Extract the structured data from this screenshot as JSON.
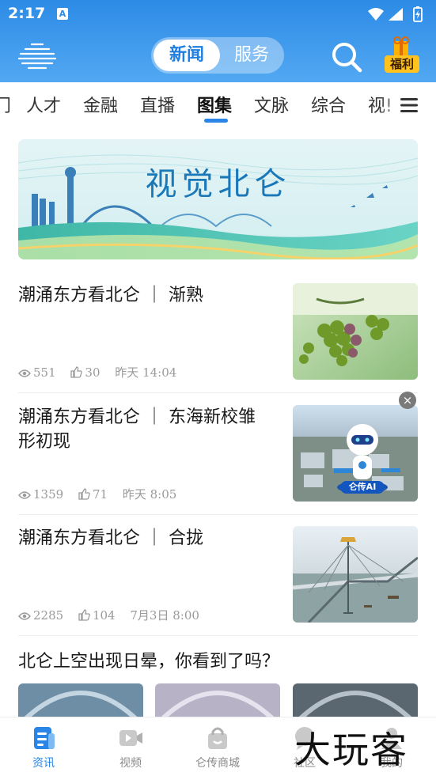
{
  "status_bar": {
    "time": "2:17",
    "notification_icon": "A"
  },
  "header": {
    "switch": {
      "active": "新闻",
      "inactive": "服务"
    },
    "welfare_label": "福利",
    "colors": {
      "header_top": "#2d8be6",
      "accent": "#2a86e6"
    }
  },
  "tabs": [
    {
      "label": "门"
    },
    {
      "label": "人才"
    },
    {
      "label": "金融"
    },
    {
      "label": "直播"
    },
    {
      "label": "图集"
    },
    {
      "label": "文脉"
    },
    {
      "label": "综合"
    },
    {
      "label": "视!"
    }
  ],
  "active_tab": "图集",
  "banner": {
    "title": "视觉北仑"
  },
  "news": [
    {
      "title": "潮涌东方看北仑 ｜ 渐熟",
      "views": "551",
      "likes": "30",
      "time": "昨天 14:04",
      "thumb": "grapes"
    },
    {
      "title": "潮涌东方看北仑 ｜ 东海新校雏形初现",
      "views": "1359",
      "likes": "71",
      "time": "昨天 8:05",
      "thumb": "campus-aerial",
      "overlay_label": "仑传AI"
    },
    {
      "title": "潮涌东方看北仑 ｜ 合拢",
      "views": "2285",
      "likes": "104",
      "time": "7月3日 8:00",
      "thumb": "bridge"
    }
  ],
  "gallery": {
    "title": "北仑上空出现日晕，你看到了吗？"
  },
  "bottom_nav": [
    {
      "label": "资讯",
      "icon": "news-icon",
      "active": true
    },
    {
      "label": "视频",
      "icon": "video-icon",
      "active": false
    },
    {
      "label": "仑传商城",
      "icon": "shop-bag-icon",
      "active": false
    },
    {
      "label": "社区",
      "icon": "community-icon",
      "active": false
    },
    {
      "label": "我的",
      "icon": "profile-icon",
      "active": false
    }
  ],
  "watermark": "大玩客"
}
